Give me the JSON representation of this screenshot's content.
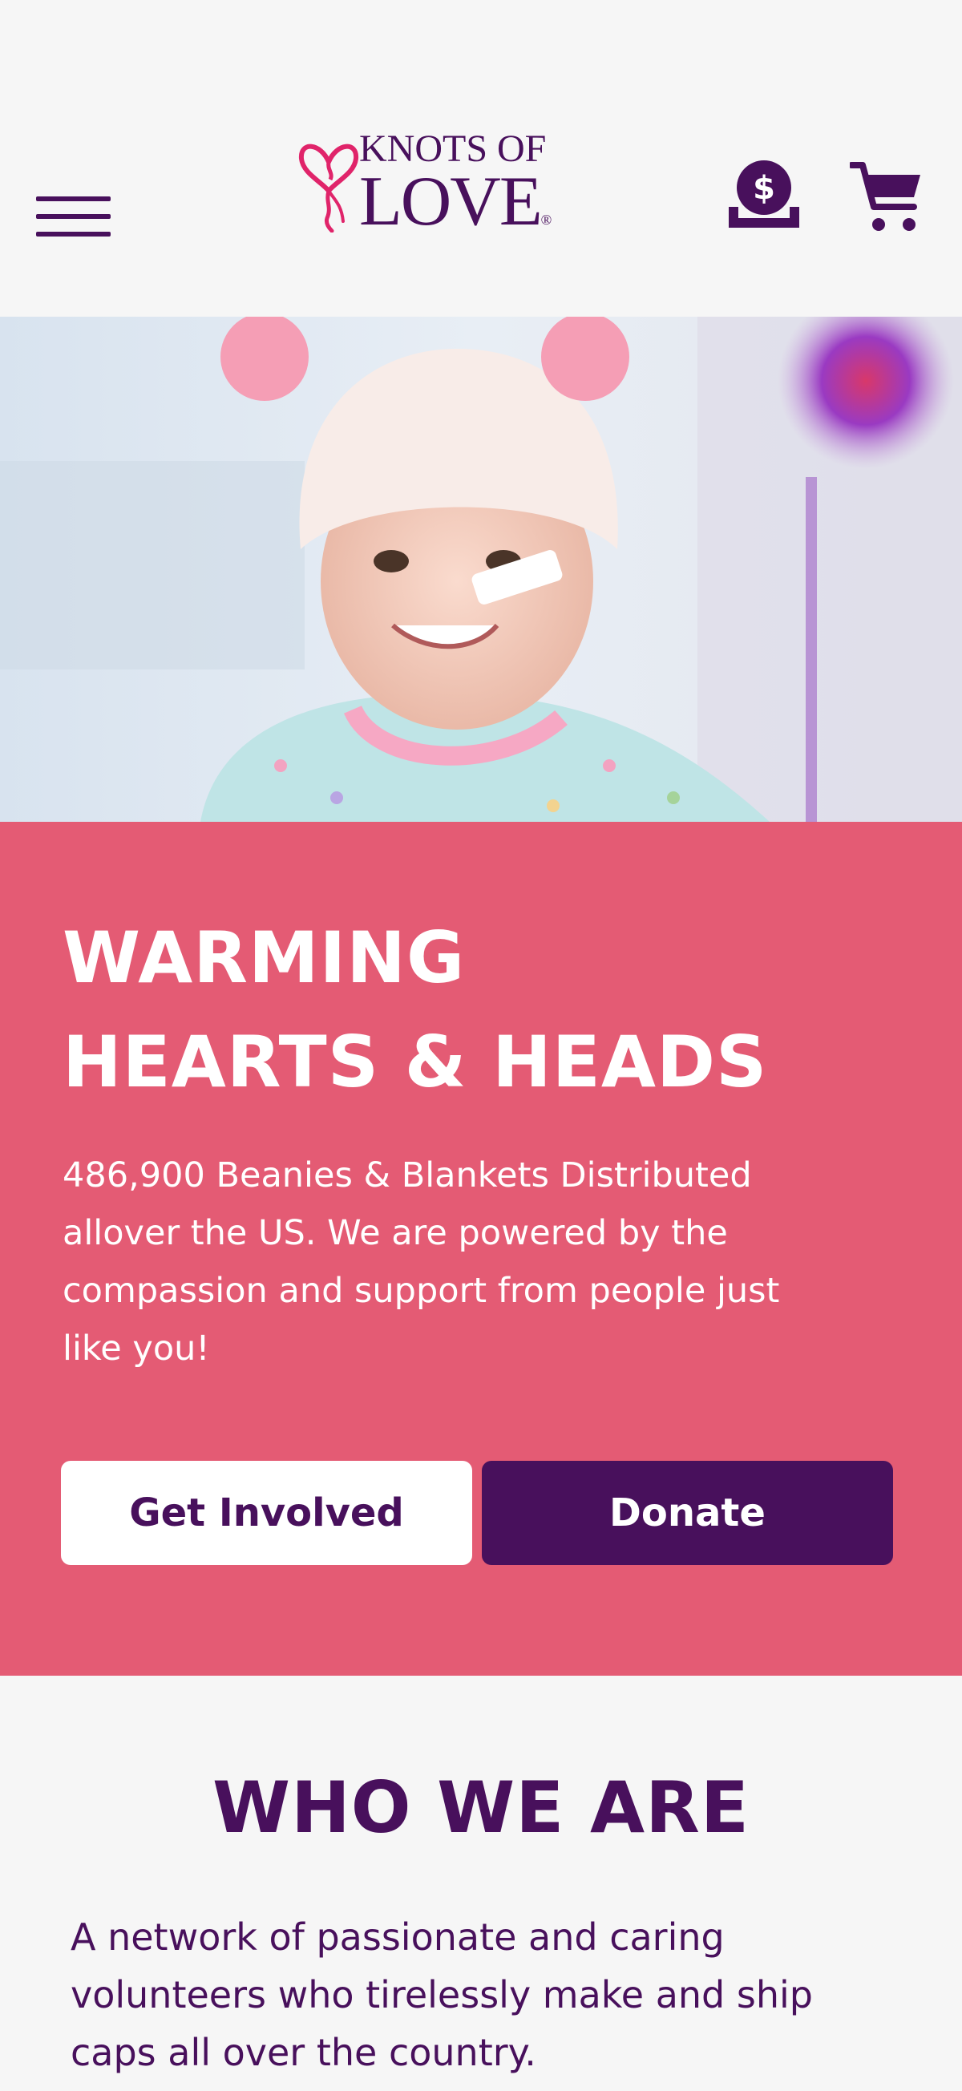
{
  "header": {
    "logo_top": "KNOTS OF",
    "logo_bottom": "LOVE",
    "logo_mark": "®",
    "menu_icon": "hamburger-menu-icon",
    "donate_icon": "donate-dollar-icon",
    "cart_icon": "shopping-cart-icon"
  },
  "hero": {
    "image": "smiling child in pink knit beanie"
  },
  "panel": {
    "title_line1": "WARMING",
    "title_line2": "HEARTS & HEADS",
    "text": "486,900 Beanies & Blankets Distributed allover the US. We are powered by the compassion and support from people just like you!",
    "get_involved_label": "Get Involved",
    "donate_label": "Donate"
  },
  "who": {
    "title": "WHO WE ARE",
    "text": "A network of passionate and caring volunteers who tirelessly make and ship caps all over the country."
  },
  "colors": {
    "brand_purple": "#48105c",
    "brand_pink": "#e45b74",
    "background": "#f6f6f6",
    "white": "#ffffff"
  }
}
